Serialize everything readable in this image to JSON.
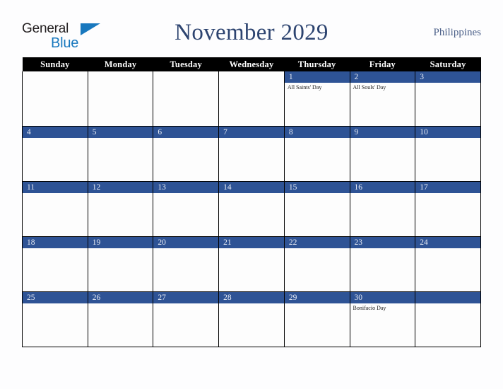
{
  "brand": {
    "word_one": "General",
    "word_two": "Blue",
    "triangle_icon": "triangle-icon",
    "accent_color": "#1878be",
    "text_color": "#231f20"
  },
  "header": {
    "title": "November 2029",
    "country": "Philippines",
    "title_color": "#2d4470",
    "country_color": "#4a5f88"
  },
  "calendar": {
    "band_color": "#2e5395",
    "header_bg": "#000000",
    "header_text_color": "#ffffff",
    "weekday_headers": [
      "Sunday",
      "Monday",
      "Tuesday",
      "Wednesday",
      "Thursday",
      "Friday",
      "Saturday"
    ],
    "weeks": [
      [
        {
          "day": "",
          "banded": false,
          "events": []
        },
        {
          "day": "",
          "banded": false,
          "events": []
        },
        {
          "day": "",
          "banded": false,
          "events": []
        },
        {
          "day": "",
          "banded": false,
          "events": []
        },
        {
          "day": "1",
          "banded": true,
          "events": [
            "All Saints' Day"
          ]
        },
        {
          "day": "2",
          "banded": true,
          "events": [
            "All Souls' Day"
          ]
        },
        {
          "day": "3",
          "banded": true,
          "events": []
        }
      ],
      [
        {
          "day": "4",
          "banded": true,
          "events": []
        },
        {
          "day": "5",
          "banded": true,
          "events": []
        },
        {
          "day": "6",
          "banded": true,
          "events": []
        },
        {
          "day": "7",
          "banded": true,
          "events": []
        },
        {
          "day": "8",
          "banded": true,
          "events": []
        },
        {
          "day": "9",
          "banded": true,
          "events": []
        },
        {
          "day": "10",
          "banded": true,
          "events": []
        }
      ],
      [
        {
          "day": "11",
          "banded": true,
          "events": []
        },
        {
          "day": "12",
          "banded": true,
          "events": []
        },
        {
          "day": "13",
          "banded": true,
          "events": []
        },
        {
          "day": "14",
          "banded": true,
          "events": []
        },
        {
          "day": "15",
          "banded": true,
          "events": []
        },
        {
          "day": "16",
          "banded": true,
          "events": []
        },
        {
          "day": "17",
          "banded": true,
          "events": []
        }
      ],
      [
        {
          "day": "18",
          "banded": true,
          "events": []
        },
        {
          "day": "19",
          "banded": true,
          "events": []
        },
        {
          "day": "20",
          "banded": true,
          "events": []
        },
        {
          "day": "21",
          "banded": true,
          "events": []
        },
        {
          "day": "22",
          "banded": true,
          "events": []
        },
        {
          "day": "23",
          "banded": true,
          "events": []
        },
        {
          "day": "24",
          "banded": true,
          "events": []
        }
      ],
      [
        {
          "day": "25",
          "banded": true,
          "events": []
        },
        {
          "day": "26",
          "banded": true,
          "events": []
        },
        {
          "day": "27",
          "banded": true,
          "events": []
        },
        {
          "day": "28",
          "banded": true,
          "events": []
        },
        {
          "day": "29",
          "banded": true,
          "events": []
        },
        {
          "day": "30",
          "banded": true,
          "events": [
            "Bonifacio Day"
          ]
        },
        {
          "day": "",
          "banded": true,
          "events": []
        }
      ]
    ]
  }
}
